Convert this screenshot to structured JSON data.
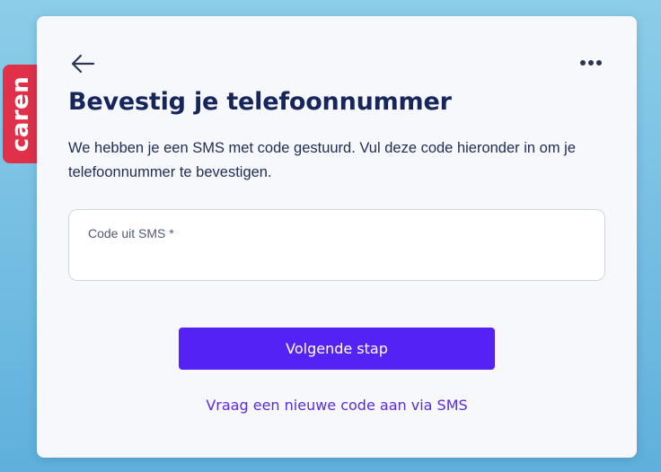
{
  "brand": {
    "name": "caren",
    "color": "#e0304a"
  },
  "header": {
    "back_icon": "arrow-left-icon",
    "more_icon": "more-horizontal-icon",
    "title": "Bevestig je telefoonnummer"
  },
  "main": {
    "description": "We hebben je een SMS met code gestuurd. Vul deze code hieronder in om je telefoonnummer te bevestigen.",
    "code_field": {
      "label": "Code uit SMS *",
      "value": ""
    },
    "next_button_label": "Volgende stap",
    "resend_link_label": "Vraag een nieuwe code aan via SMS"
  },
  "colors": {
    "accent": "#5522f5",
    "title": "#16255c",
    "background": "#7dc3e5"
  }
}
